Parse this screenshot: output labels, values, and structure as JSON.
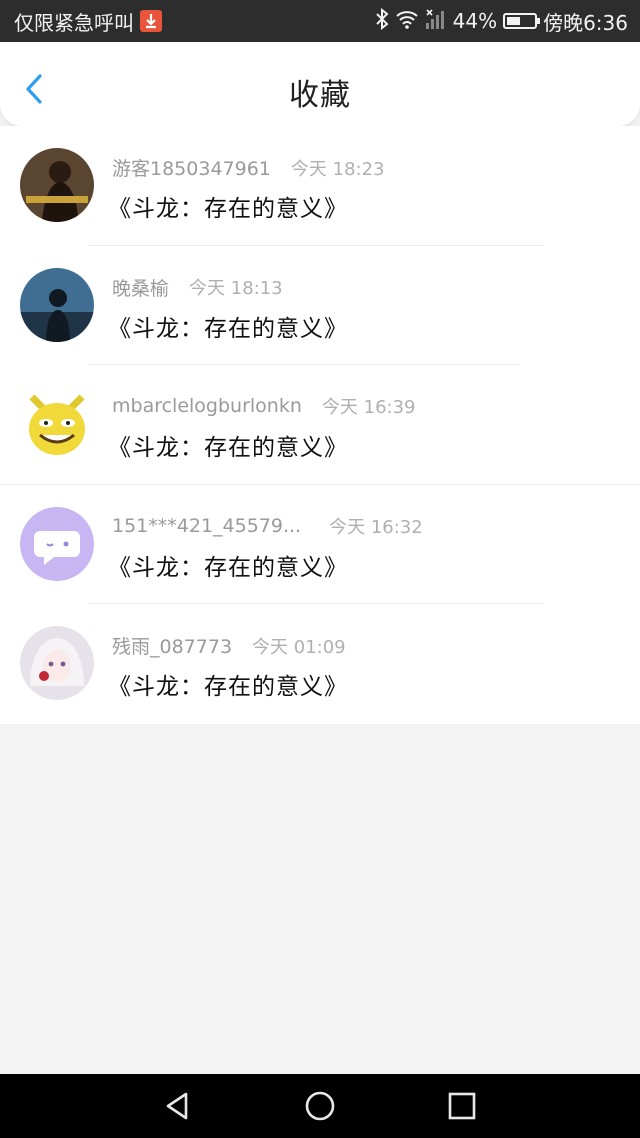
{
  "status_bar": {
    "left_text": "仅限紧急呼叫",
    "battery": "44%",
    "time": "傍晚6:36"
  },
  "header": {
    "title": "收藏",
    "back_icon": "chevron-left-icon",
    "accent_color": "#2f9df0"
  },
  "favorites": [
    {
      "user": "游客1850347961",
      "time": "今天 18:23",
      "title": "《斗龙：存在的意义》",
      "avatar": "girl-dark-avatar"
    },
    {
      "user": "晚桑榆",
      "time": "今天 18:13",
      "title": "《斗龙：存在的意义》",
      "avatar": "silhouette-sky-avatar"
    },
    {
      "user": "mbarclelogburlonkn",
      "time": "今天 16:39",
      "title": "《斗龙：存在的意义》",
      "avatar": "yellow-meme-avatar"
    },
    {
      "user": "151***421_45579...",
      "time": "今天 16:32",
      "title": "《斗龙：存在的意义》",
      "avatar": "purple-chat-avatar"
    },
    {
      "user": "残雨_087773",
      "time": "今天 01:09",
      "title": "《斗龙：存在的意义》",
      "avatar": "anime-girl-avatar"
    }
  ],
  "nav": {
    "back": "triangle-back-icon",
    "home": "circle-home-icon",
    "recent": "square-recent-icon"
  }
}
